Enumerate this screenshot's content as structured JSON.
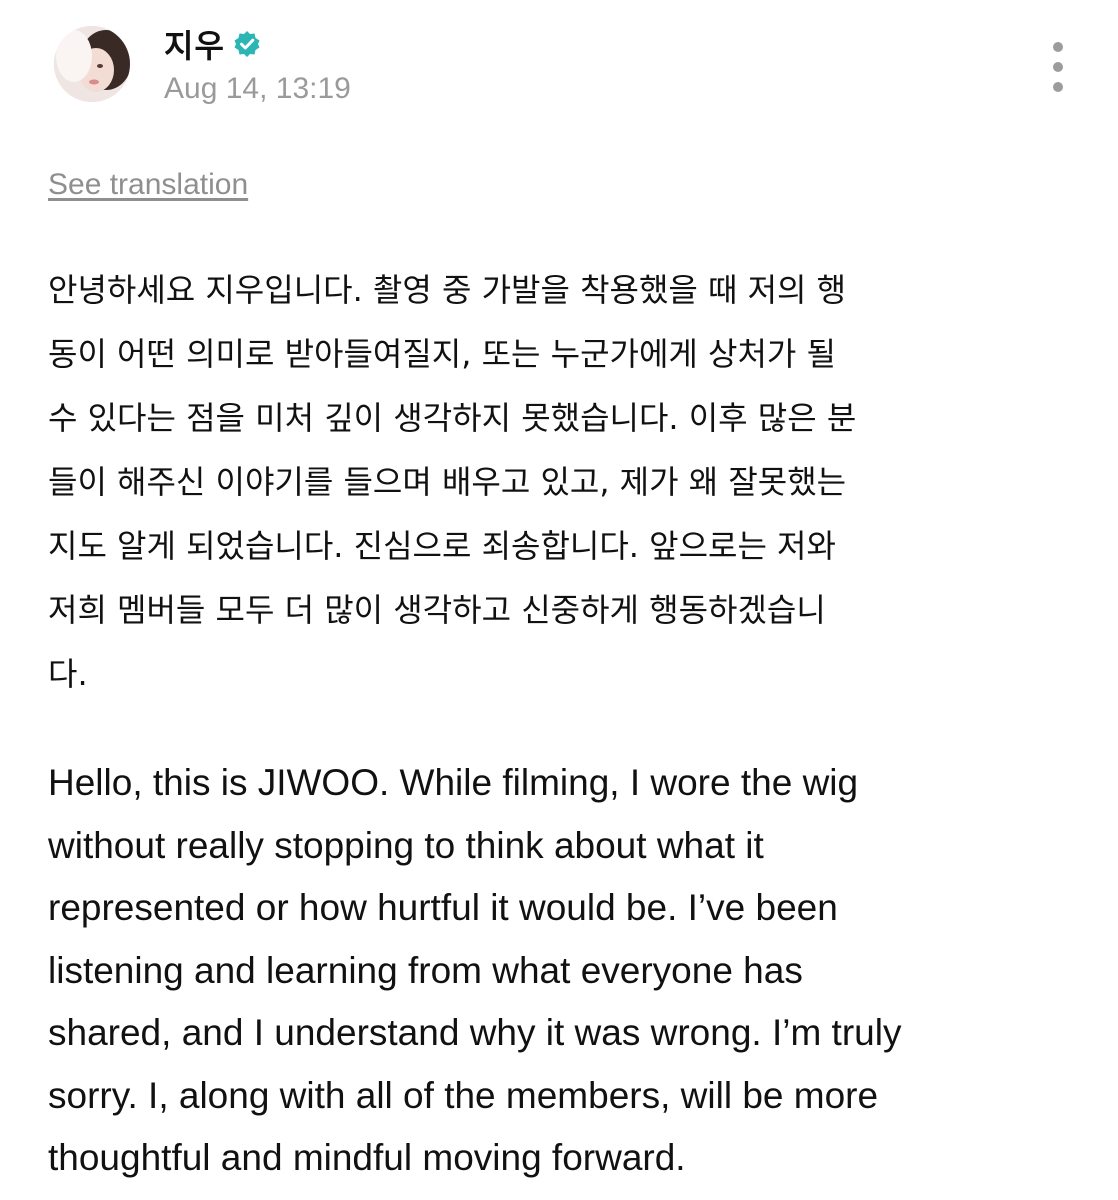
{
  "post": {
    "author": {
      "name": "지우",
      "verified_icon": "verified-check-icon",
      "avatar_icon": "avatar"
    },
    "timestamp": "Aug 14, 13:19",
    "more_icon": "more-vertical-icon",
    "see_translation_label": "See translation",
    "body_korean": "안녕하세요 지우입니다. 촬영 중 가발을 착용했을 때 저의 행\n동이 어떤 의미로 받아들여질지, 또는 누군가에게 상처가 될\n수 있다는 점을 미처 깊이 생각하지 못했습니다. 이후 많은 분\n들이 해주신 이야기를 들으며 배우고 있고, 제가 왜 잘못했는\n지도 알게 되었습니다. 진심으로 죄송합니다. 앞으로는 저와\n저희 멤버들 모두 더 많이 생각하고 신중하게 행동하겠습니\n다.",
    "body_english": " Hello, this is JIWOO. While filming, I wore the wig\nwithout really stopping to think about what it\nrepresented or how hurtful it would be. I’ve been\nlistening and learning from what everyone has\nshared, and I understand why it was wrong. I’m truly\nsorry. I, along with all of the members, will be more\nthoughtful and mindful moving forward.",
    "colors": {
      "verified": "#2bb5b5",
      "timestamp": "#9a9a9a",
      "link": "#8f8f8f",
      "text": "#111111"
    }
  }
}
